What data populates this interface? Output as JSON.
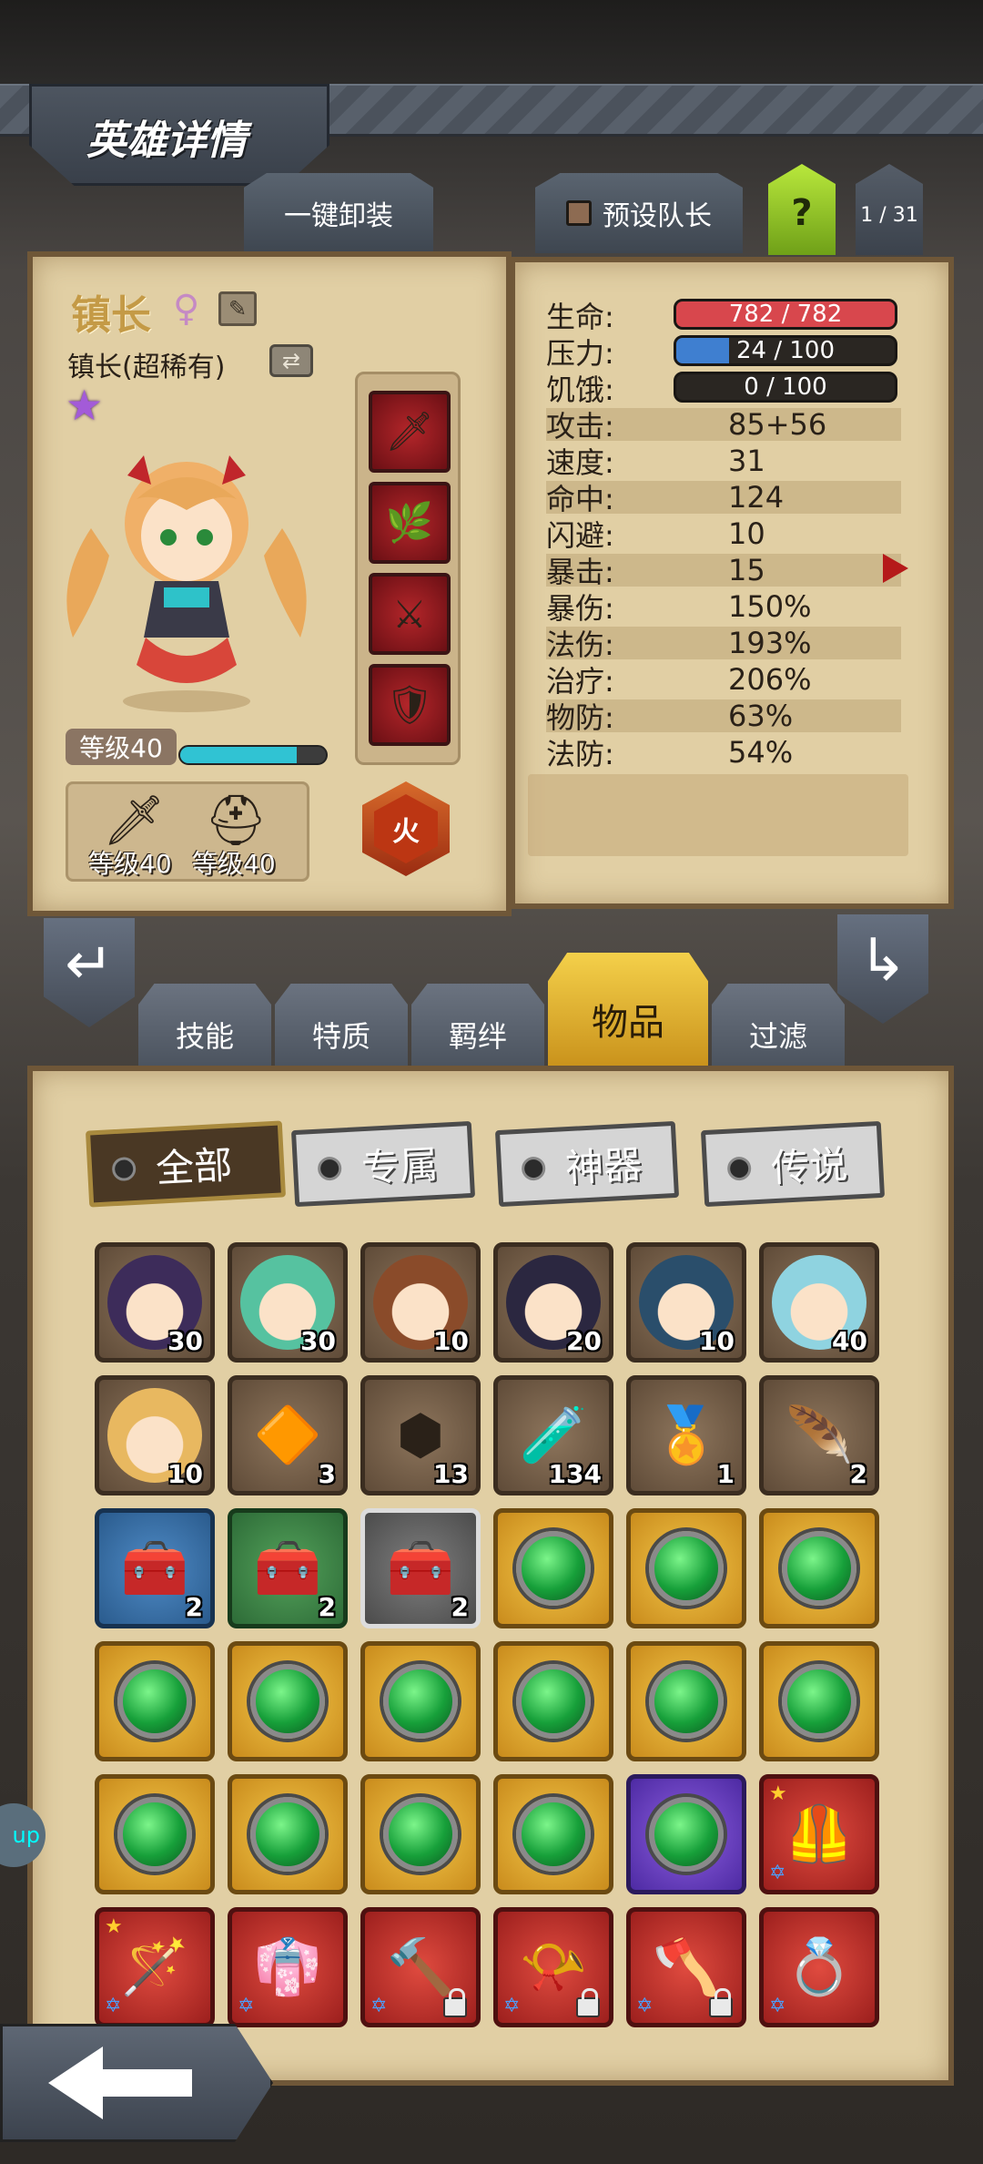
{
  "header": {
    "title": "英雄详情"
  },
  "top_tabs": {
    "unequip_all": "一键卸装",
    "preset_leader": "预设队长",
    "help": "?",
    "page": "1 / 31"
  },
  "hero": {
    "name": "镇长",
    "gender_symbol": "♀",
    "class": "镇长(超稀有)",
    "level": "等级40",
    "exp_fraction": 0.8,
    "equip_levels": [
      "等级40",
      "等级40"
    ],
    "element": "火",
    "equipment_icons": [
      "scythe-icon",
      "green-blade-icon",
      "sword-icon",
      "shield-icon"
    ]
  },
  "stats": {
    "bars": [
      {
        "label": "生命:",
        "value": "782 / 782",
        "fraction": 1.0,
        "color": "#d8474d"
      },
      {
        "label": "压力:",
        "value": "24 / 100",
        "fraction": 0.24,
        "color": "#3f7fd0"
      },
      {
        "label": "饥饿:",
        "value": "0 / 100",
        "fraction": 0.0,
        "color": "#888888"
      }
    ],
    "rows": [
      {
        "label": "攻击:",
        "value": "85+56"
      },
      {
        "label": "速度:",
        "value": "31"
      },
      {
        "label": "命中:",
        "value": "124"
      },
      {
        "label": "闪避:",
        "value": "10"
      },
      {
        "label": "暴击:",
        "value": "15"
      },
      {
        "label": "暴伤:",
        "value": "150%"
      },
      {
        "label": "法伤:",
        "value": "193%"
      },
      {
        "label": "治疗:",
        "value": "206%"
      },
      {
        "label": "物防:",
        "value": "63%"
      },
      {
        "label": "法防:",
        "value": "54%"
      }
    ]
  },
  "category_tabs": [
    "技能",
    "特质",
    "羁绊",
    "物品",
    "过滤"
  ],
  "active_category": "物品",
  "filters": [
    "全部",
    "专属",
    "神器",
    "传说"
  ],
  "active_filter": "全部",
  "items": [
    {
      "type": "hero",
      "count": "30",
      "frame": "brown",
      "icon": "hero-portrait"
    },
    {
      "type": "hero",
      "count": "30",
      "frame": "brown",
      "icon": "hero-portrait"
    },
    {
      "type": "hero",
      "count": "10",
      "frame": "brown",
      "icon": "hero-portrait"
    },
    {
      "type": "hero",
      "count": "20",
      "frame": "brown",
      "icon": "hero-portrait"
    },
    {
      "type": "hero",
      "count": "10",
      "frame": "brown",
      "icon": "hero-portrait"
    },
    {
      "type": "hero",
      "count": "40",
      "frame": "brown",
      "icon": "hero-portrait"
    },
    {
      "type": "hero",
      "count": "10",
      "frame": "brown",
      "icon": "hero-portrait"
    },
    {
      "type": "rune",
      "count": "3",
      "frame": "brown",
      "icon": "orange-rune-icon"
    },
    {
      "type": "rune",
      "count": "13",
      "frame": "brown",
      "icon": "teal-rune-icon"
    },
    {
      "type": "potion",
      "count": "134",
      "frame": "brown",
      "icon": "potion-icon"
    },
    {
      "type": "medal",
      "count": "1",
      "frame": "brown",
      "icon": "gold-medal-icon"
    },
    {
      "type": "feather",
      "count": "2",
      "frame": "brown",
      "icon": "feather-icon"
    },
    {
      "type": "chest",
      "count": "2",
      "frame": "blue",
      "icon": "chest-icon"
    },
    {
      "type": "chest",
      "count": "2",
      "frame": "green",
      "icon": "chest-icon"
    },
    {
      "type": "chest",
      "count": "2",
      "frame": "gray",
      "icon": "chest-icon"
    },
    {
      "type": "gem",
      "count": "",
      "frame": "gold",
      "icon": "green-gem-icon"
    },
    {
      "type": "gem",
      "count": "",
      "frame": "gold",
      "icon": "green-gem-icon"
    },
    {
      "type": "gem",
      "count": "",
      "frame": "gold",
      "icon": "green-gem-icon"
    },
    {
      "type": "gem",
      "count": "",
      "frame": "gold",
      "icon": "green-gem-icon"
    },
    {
      "type": "gem",
      "count": "",
      "frame": "gold",
      "icon": "green-gem-icon"
    },
    {
      "type": "gem",
      "count": "",
      "frame": "gold",
      "icon": "green-gem-icon"
    },
    {
      "type": "gem",
      "count": "",
      "frame": "gold",
      "icon": "green-gem-icon"
    },
    {
      "type": "gem",
      "count": "",
      "frame": "gold",
      "icon": "green-gem-icon"
    },
    {
      "type": "gem",
      "count": "",
      "frame": "gold",
      "icon": "green-gem-icon"
    },
    {
      "type": "gem",
      "count": "",
      "frame": "gold",
      "icon": "green-gem-icon"
    },
    {
      "type": "gem",
      "count": "",
      "frame": "gold",
      "icon": "green-gem-icon"
    },
    {
      "type": "gem",
      "count": "",
      "frame": "gold",
      "icon": "green-gem-icon"
    },
    {
      "type": "gem",
      "count": "",
      "frame": "gold",
      "icon": "green-gem-icon"
    },
    {
      "type": "gem",
      "count": "",
      "frame": "purple",
      "icon": "green-gem-icon"
    },
    {
      "type": "armor",
      "count": "",
      "frame": "red",
      "icon": "armor-icon"
    },
    {
      "type": "weapon",
      "count": "",
      "frame": "red",
      "icon": "staff-icon"
    },
    {
      "type": "armor",
      "count": "",
      "frame": "red",
      "icon": "robe-icon"
    },
    {
      "type": "weapon",
      "count": "",
      "frame": "red",
      "icon": "hammer-icon"
    },
    {
      "type": "accessory",
      "count": "",
      "frame": "red",
      "icon": "horn-icon"
    },
    {
      "type": "weapon",
      "count": "",
      "frame": "red",
      "icon": "axe-icon"
    },
    {
      "type": "accessory",
      "count": "",
      "frame": "red",
      "icon": "ring-icon"
    }
  ],
  "colors": {
    "accent_gold": "#f4d04a",
    "parchment": "#e1cfa4",
    "steel": "#4a525d"
  }
}
